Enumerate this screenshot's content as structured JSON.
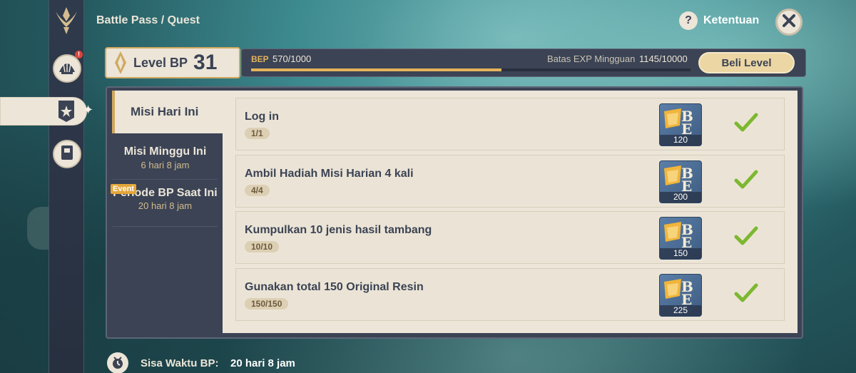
{
  "header": {
    "breadcrumb": "Battle Pass / Quest",
    "rules_icon": "?",
    "rules_label": "Ketentuan"
  },
  "level": {
    "label": "Level BP",
    "value": "31",
    "bep_label": "BEP",
    "bep_value": "570/1000",
    "bep_progress": 0.57,
    "weekly_label": "Batas EXP Mingguan",
    "weekly_value": "1145/10000",
    "buy_button": "Beli Level"
  },
  "tabs": {
    "daily": "Misi Hari Ini",
    "weekly": "Misi Minggu Ini",
    "weekly_time": "6 hari 8 jam",
    "period": "Periode BP Saat Ini",
    "period_time": "20 hari 8 jam",
    "event_badge": "Event"
  },
  "quests": [
    {
      "name": "Log in",
      "progress": "1/1",
      "reward": "120",
      "completed": true
    },
    {
      "name": "Ambil Hadiah Misi Harian 4 kali",
      "progress": "4/4",
      "reward": "200",
      "completed": true
    },
    {
      "name": "Kumpulkan 10 jenis hasil tambang",
      "progress": "10/10",
      "reward": "150",
      "completed": true
    },
    {
      "name": "Gunakan total 150 Original Resin",
      "progress": "150/150",
      "reward": "225",
      "completed": true
    }
  ],
  "footer": {
    "label": "Sisa Waktu BP:",
    "value": "20 hari 8 jam"
  },
  "sidebar": {
    "notification_badge": "!"
  },
  "icons": {
    "logo": "battle-pass-emblem-icon",
    "shell": "shell-icon",
    "quest": "quest-banner-icon",
    "notebook": "notebook-icon",
    "close": "close-icon",
    "check": "check-icon",
    "reward": "bp-exp-icon",
    "timer": "timer-icon"
  },
  "colors": {
    "gold": "#e3b45b",
    "cream": "#ece5d8",
    "dark": "#3b4354",
    "check": "#7cb82f"
  }
}
